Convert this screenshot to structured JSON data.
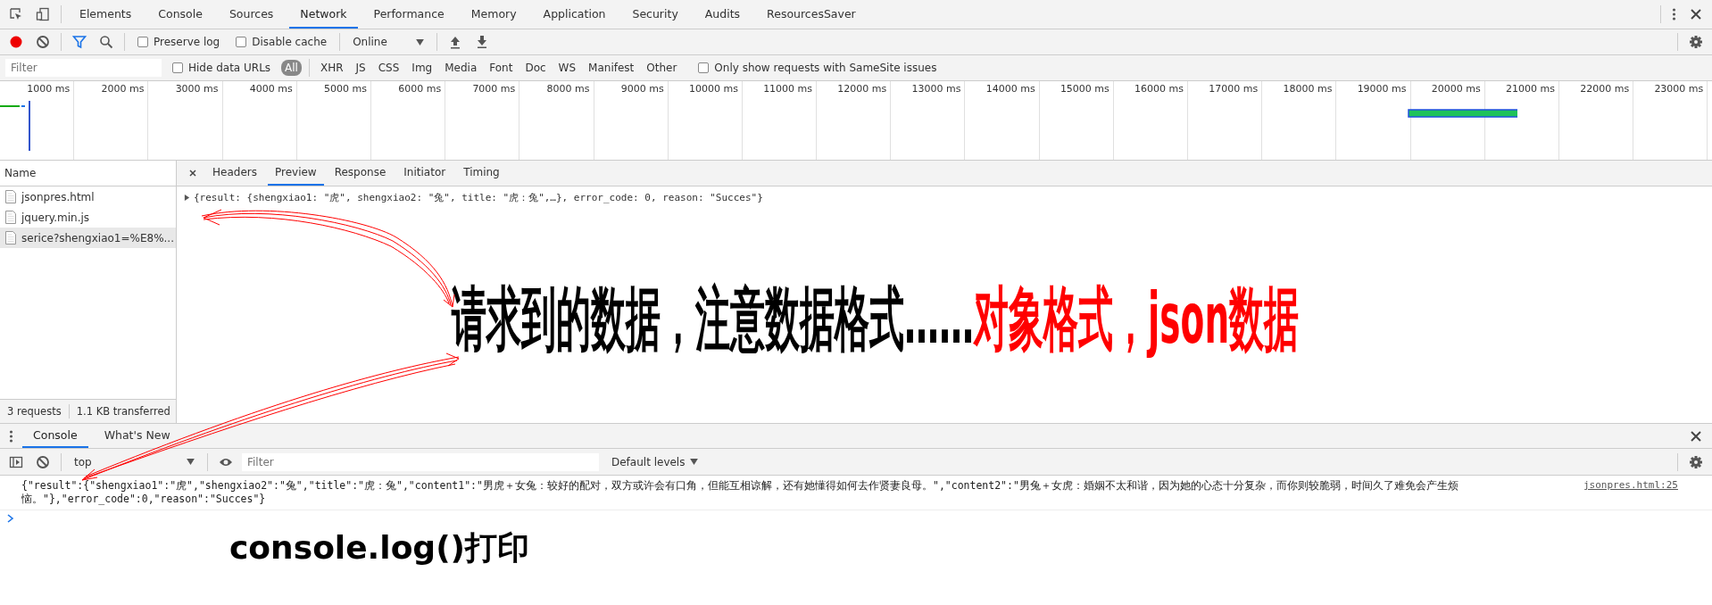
{
  "panel_tabs": [
    {
      "label": "Elements",
      "selected": false
    },
    {
      "label": "Console",
      "selected": false
    },
    {
      "label": "Sources",
      "selected": false
    },
    {
      "label": "Network",
      "selected": true
    },
    {
      "label": "Performance",
      "selected": false
    },
    {
      "label": "Memory",
      "selected": false
    },
    {
      "label": "Application",
      "selected": false
    },
    {
      "label": "Security",
      "selected": false
    },
    {
      "label": "Audits",
      "selected": false
    },
    {
      "label": "ResourcesSaver",
      "selected": false
    }
  ],
  "network_toolbar": {
    "recording": true,
    "preserve_log": {
      "label": "Preserve log",
      "checked": false
    },
    "disable_cache": {
      "label": "Disable cache",
      "checked": false
    },
    "throttling": "Online"
  },
  "filter_bar": {
    "placeholder": "Filter",
    "hide_data_urls": {
      "label": "Hide data URLs",
      "checked": false
    },
    "types": [
      {
        "label": "All",
        "selected": true
      },
      {
        "label": "XHR",
        "selected": false
      },
      {
        "label": "JS",
        "selected": false
      },
      {
        "label": "CSS",
        "selected": false
      },
      {
        "label": "Img",
        "selected": false
      },
      {
        "label": "Media",
        "selected": false
      },
      {
        "label": "Font",
        "selected": false
      },
      {
        "label": "Doc",
        "selected": false
      },
      {
        "label": "WS",
        "selected": false
      },
      {
        "label": "Manifest",
        "selected": false
      },
      {
        "label": "Other",
        "selected": false
      }
    ],
    "samesite": {
      "label": "Only show requests with SameSite issues",
      "checked": false
    }
  },
  "timeline": {
    "ticks": [
      "1000 ms",
      "2000 ms",
      "3000 ms",
      "4000 ms",
      "5000 ms",
      "6000 ms",
      "7000 ms",
      "8000 ms",
      "9000 ms",
      "10000 ms",
      "11000 ms",
      "12000 ms",
      "13000 ms",
      "14000 ms",
      "15000 ms",
      "16000 ms",
      "17000 ms",
      "18000 ms",
      "19000 ms",
      "20000 ms",
      "21000 ms",
      "22000 ms",
      "23000 ms"
    ]
  },
  "requests": {
    "header": "Name",
    "rows": [
      {
        "name": "jsonpres.html",
        "selected": false
      },
      {
        "name": "jquery.min.js",
        "selected": false
      },
      {
        "name": "serice?shengxiao1=%E8%...",
        "selected": true
      }
    ],
    "summary": [
      "3 requests",
      "1.1 KB transferred"
    ]
  },
  "detail_tabs": [
    {
      "label": "Headers",
      "selected": false
    },
    {
      "label": "Preview",
      "selected": true
    },
    {
      "label": "Response",
      "selected": false
    },
    {
      "label": "Initiator",
      "selected": false
    },
    {
      "label": "Timing",
      "selected": false
    }
  ],
  "preview": {
    "expanded": false,
    "text": "{result: {shengxiao1: \"虎\", shengxiao2: \"兔\", title: \"虎：兔\",…}, error_code: 0, reason: \"Succes\"}"
  },
  "drawer_tabs": [
    {
      "label": "Console",
      "selected": true
    },
    {
      "label": "What's New",
      "selected": false
    }
  ],
  "console_toolbar": {
    "context": "top",
    "placeholder": "Filter",
    "levels": "Default levels"
  },
  "console_messages": [
    {
      "text": "{\"result\":{\"shengxiao1\":\"虎\",\"shengxiao2\":\"兔\",\"title\":\"虎：兔\",\"content1\":\"男虎＋女兔：较好的配对，双方或许会有口角，但能互相谅解，还有她懂得如何去作贤妻良母。\",\"content2\":\"男兔＋女虎：婚姻不太和谐，因为她的心态十分复杂，而你则较脆弱，时间久了难免会产生烦恼。\"},\"error_code\":0,\"reason\":\"Succes\"}",
      "source": "jsonpres.html:25"
    }
  ],
  "annotations": {
    "headline": [
      {
        "text": "请求到的数据，注意数据格式……",
        "color": "#000000"
      },
      {
        "text": "对象格式，json数据",
        "color": "#ff0000"
      }
    ],
    "caption": "console.log()打印"
  }
}
